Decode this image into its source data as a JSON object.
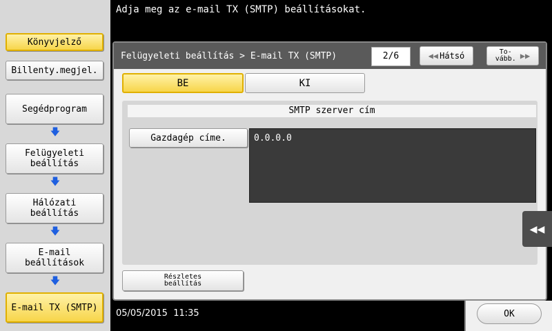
{
  "instruction": "Adja meg az e-mail TX (SMTP) beállításokat.",
  "sidebar": {
    "bookmark": "Könyvjelző",
    "keyboard": "Billenty.megjel.",
    "path": [
      "Segédprogram",
      "Felügyeleti\nbeállítás",
      "Hálózati\nbeállítás",
      "E-mail\nbeállítások",
      "E-mail TX (SMTP)"
    ]
  },
  "header": {
    "title": "Felügyeleti beállítás > E-mail TX (SMTP)",
    "page": "2/6",
    "back_label": "Hátsó",
    "next_label": "To-\nvább."
  },
  "toggle": {
    "on_label": "BE",
    "off_label": "KI",
    "selected": "BE"
  },
  "smtp": {
    "section_title": "SMTP szerver cím",
    "host_button": "Gazdagép címe.",
    "host_value": "0.0.0.0"
  },
  "detail_button": "Részletes\nbeállítás",
  "status": {
    "date": "05/05/2015",
    "time": "11:35"
  },
  "ok_label": "OK",
  "colors": {
    "accent_yellow": "#f7d54a",
    "header_gray": "#5a5a5a",
    "arrow_blue": "#1e5fe0"
  }
}
